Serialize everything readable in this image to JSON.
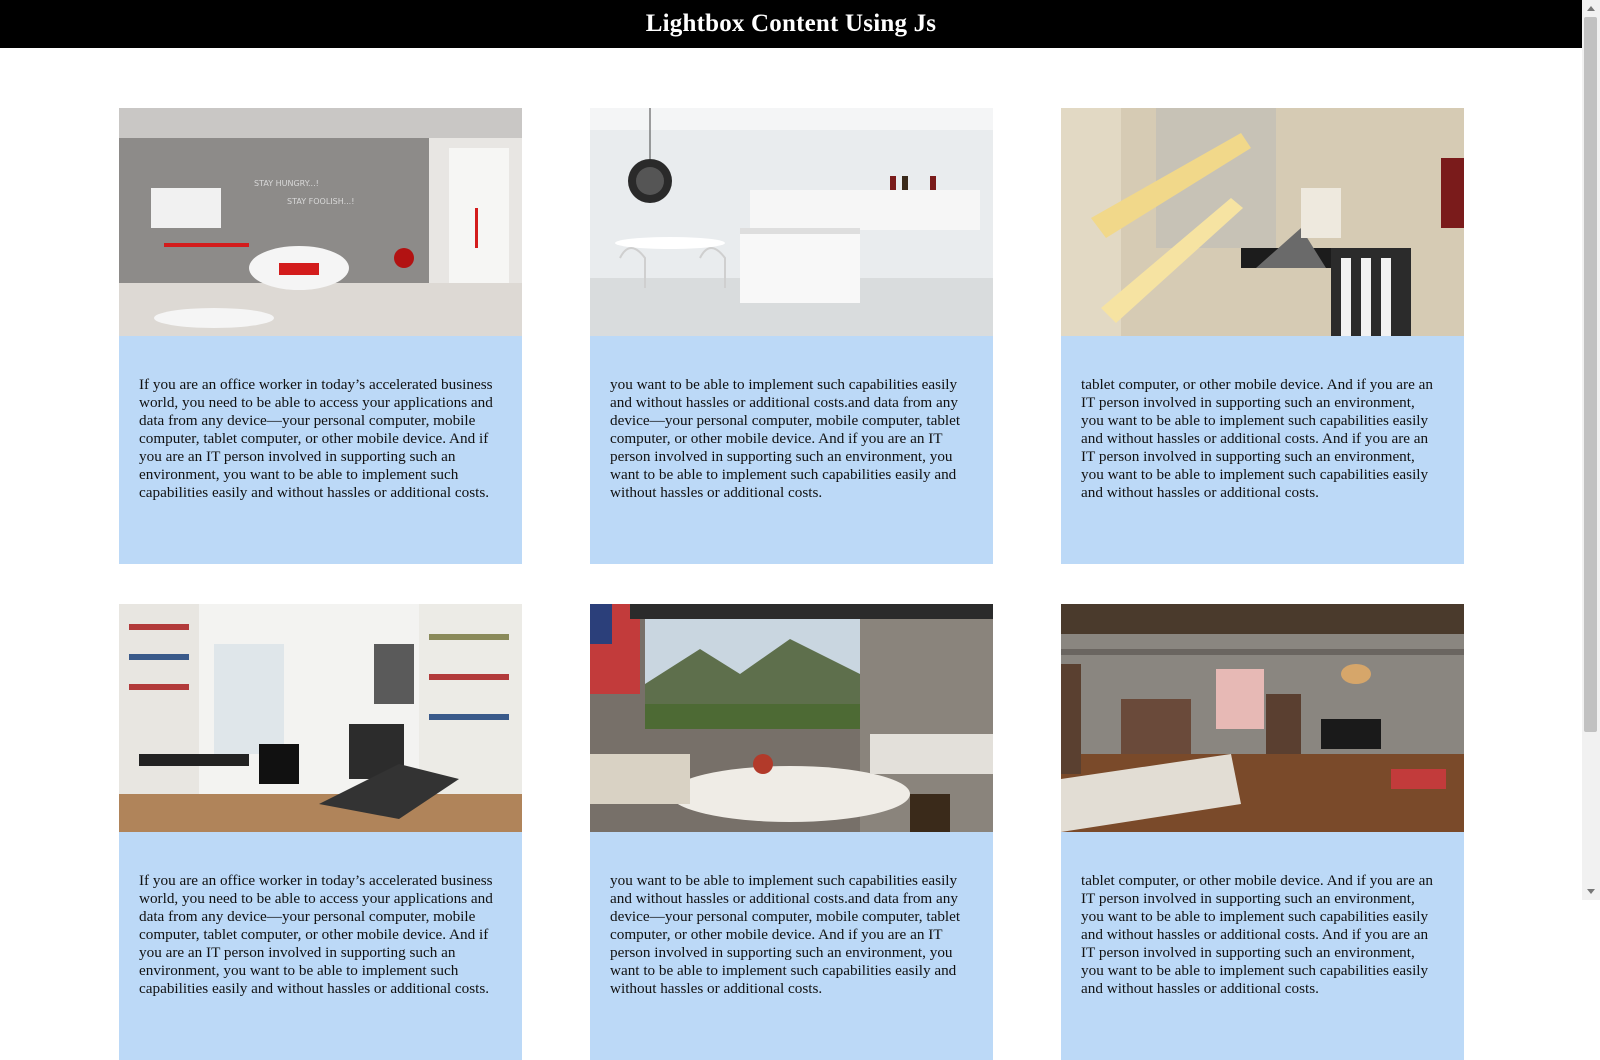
{
  "header": {
    "title": "Lightbox Content Using Js"
  },
  "cards": [
    {
      "image": "kids-bedroom-photo",
      "text": "If you are an office worker in today’s accelerated business world, you need to be able to access your applications and data from any device—your personal computer, mobile computer, tablet computer, or other mobile device. And if you are an IT person involved in supporting such an environment, you want to be able to implement such capabilities easily and without hassles or additional costs."
    },
    {
      "image": "white-kitchen-photo",
      "text": "you want to be able to implement such capabilities easily and without hassles or additional costs.and data from any device—your personal computer, mobile computer, tablet computer, or other mobile device. And if you are an IT person involved in supporting such an environment, you want to be able to implement such capabilities easily and without hassles or additional costs."
    },
    {
      "image": "staircase-photo",
      "text": "tablet computer, or other mobile device. And if you are an IT person involved in supporting such an environment, you want to be able to implement such capabilities easily and without hassles or additional costs. And if you are an IT person involved in supporting such an environment, you want to be able to implement such capabilities easily and without hassles or additional costs."
    },
    {
      "image": "library-room-photo",
      "text": "If you are an office worker in today’s accelerated business world, you need to be able to access your applications and data from any device—your personal computer, mobile computer, tablet computer, or other mobile device. And if you are an IT person involved in supporting such an environment, you want to be able to implement such capabilities easily and without hassles or additional costs."
    },
    {
      "image": "mountain-view-living-room-photo",
      "text": "you want to be able to implement such capabilities easily and without hassles or additional costs.and data from any device—your personal computer, mobile computer, tablet computer, or other mobile device. And if you are an IT person involved in supporting such an environment, you want to be able to implement such capabilities easily and without hassles or additional costs."
    },
    {
      "image": "loft-bedroom-photo",
      "text": "tablet computer, or other mobile device. And if you are an IT person involved in supporting such an environment, you want to be able to implement such capabilities easily and without hassles or additional costs. And if you are an IT person involved in supporting such an environment, you want to be able to implement such capabilities easily and without hassles or additional costs."
    }
  ],
  "colors": {
    "header_bg": "#000000",
    "card_bg": "#bcd9f7",
    "page_bg": "#ffffff"
  }
}
